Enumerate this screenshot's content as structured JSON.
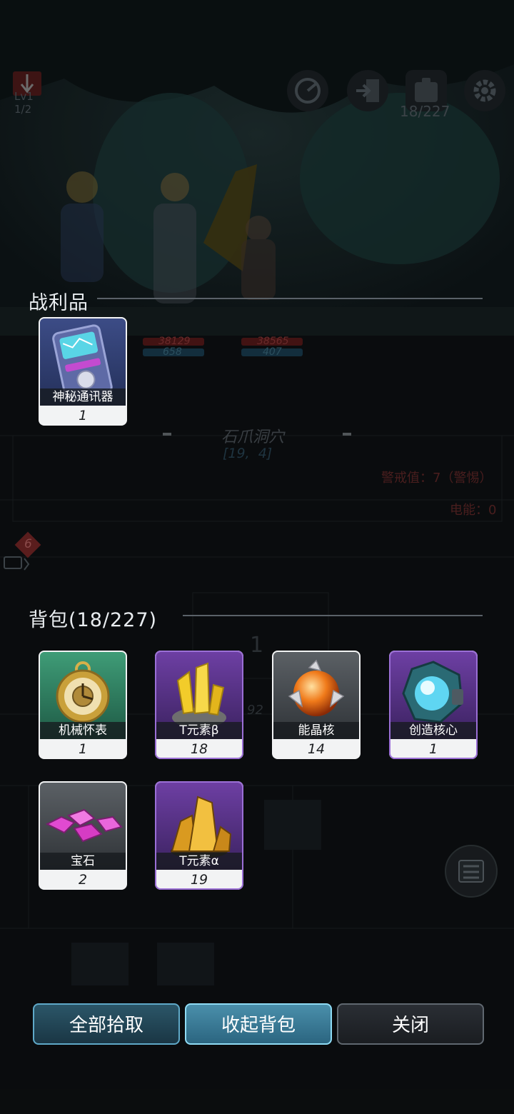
{
  "hud": {
    "level": "Lv1",
    "level_progress": "1/2",
    "bag_count": "18/227"
  },
  "battle": {
    "hp_a": "38129",
    "sp_a": "658",
    "hp_b": "38565",
    "sp_b": "407"
  },
  "location": {
    "name": "石爪洞穴",
    "coords": "[19,  4]",
    "alert": "警戒值：7（警惕）",
    "power": "电能：0"
  },
  "chat_badge": "6",
  "map_faint": {
    "depth": "1",
    "value": "92"
  },
  "loot": {
    "title": "战利品",
    "items": [
      {
        "name": "神秘通讯器",
        "count": "1",
        "rarity": "blue",
        "icon": "device-card-icon"
      }
    ]
  },
  "backpack": {
    "title": "背包(18/227)",
    "items": [
      {
        "name": "机械怀表",
        "count": "1",
        "rarity": "green",
        "icon": "pocket-watch-icon"
      },
      {
        "name": "T元素β",
        "count": "18",
        "rarity": "purple",
        "icon": "yellow-crystal-icon"
      },
      {
        "name": "能晶核",
        "count": "14",
        "rarity": "gray",
        "icon": "energy-core-icon"
      },
      {
        "name": "创造核心",
        "count": "1",
        "rarity": "purple",
        "icon": "creation-core-icon"
      },
      {
        "name": "宝石",
        "count": "2",
        "rarity": "gray",
        "icon": "pink-gems-icon"
      },
      {
        "name": "T元素α",
        "count": "19",
        "rarity": "purple",
        "icon": "gold-ore-icon"
      }
    ]
  },
  "buttons": {
    "pickup_all": "全部拾取",
    "collapse_bag": "收起背包",
    "close": "关闭"
  },
  "colors": {
    "title_text": "#e9edf0",
    "button_primary": "#4a8fab",
    "rarity_purple": "#6d3fa3",
    "rarity_green": "#3f9c77"
  }
}
